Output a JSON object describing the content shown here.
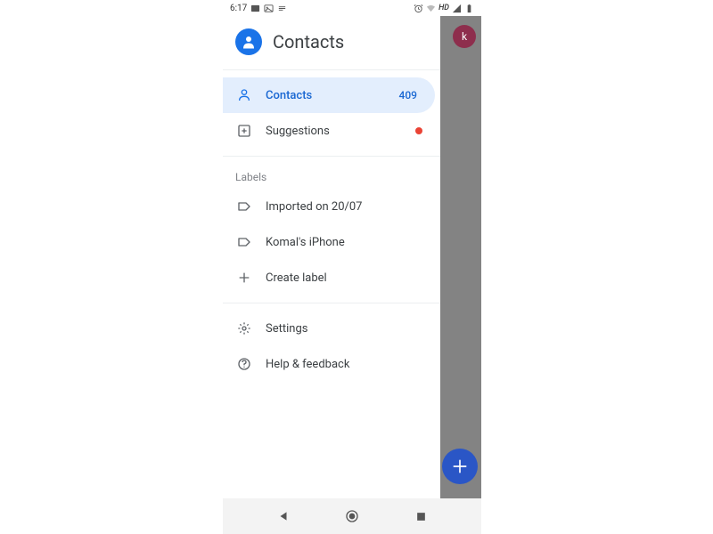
{
  "status": {
    "time": "6:17",
    "hd": "HD"
  },
  "drawer": {
    "title": "Contacts",
    "nav": {
      "contacts": {
        "label": "Contacts",
        "count": "409"
      },
      "suggestions": {
        "label": "Suggestions"
      }
    },
    "labels_header": "Labels",
    "labels": [
      {
        "label": "Imported on 20/07"
      },
      {
        "label": "Komal's iPhone"
      }
    ],
    "create_label": "Create label",
    "settings": "Settings",
    "help": "Help & feedback"
  },
  "avatar_letter": "k"
}
